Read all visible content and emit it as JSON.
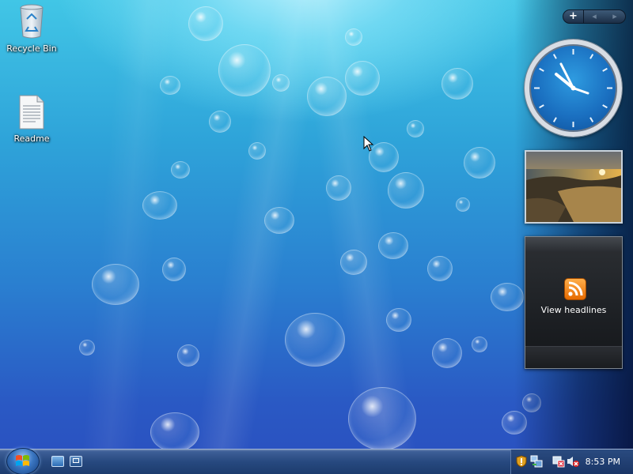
{
  "desktop": {
    "icons": [
      {
        "label": "Recycle Bin",
        "icon": "recycle-bin-icon"
      },
      {
        "label": "Readme",
        "icon": "text-document-icon"
      }
    ]
  },
  "sidebar": {
    "controls": {
      "add_label": "+",
      "prev_label": "◂",
      "next_label": "▸"
    },
    "feeds": {
      "label": "View headlines",
      "icon": "rss-feed-icon"
    }
  },
  "taskbar": {
    "start_icon": "windows-logo-icon",
    "quick_launch": [
      {
        "icon": "show-desktop-icon"
      },
      {
        "icon": "switch-windows-icon"
      }
    ],
    "tray": {
      "icons": [
        "security-shield-icon",
        "network-icon",
        "power-icon",
        "volume-muted-icon"
      ],
      "time": "8:53 PM"
    }
  },
  "colors": {
    "accent": "#2a7fd0",
    "taskbar": "#27497f",
    "rss_orange": "#f07d00"
  }
}
